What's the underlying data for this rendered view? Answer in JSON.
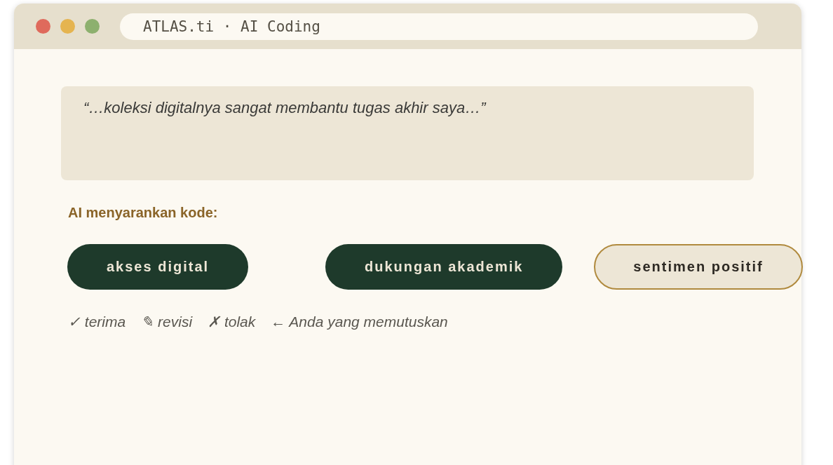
{
  "window": {
    "title": "ATLAS.ti · AI Coding"
  },
  "quote": "“…koleksi digitalnya sangat membantu tugas akhir saya…”",
  "suggestion_label": "AI menyarankan kode:",
  "codes": [
    {
      "label": "akses digital",
      "selected": true
    },
    {
      "label": "dukungan akademik",
      "selected": true
    },
    {
      "label": "sentimen positif",
      "selected": false
    }
  ],
  "actions": [
    {
      "symbol": "✓",
      "label": "terima"
    },
    {
      "symbol": "✎",
      "label": "revisi"
    },
    {
      "symbol": "✗",
      "label": "tolak"
    },
    {
      "symbol": "←",
      "label": "Anda yang memutuskan"
    }
  ]
}
